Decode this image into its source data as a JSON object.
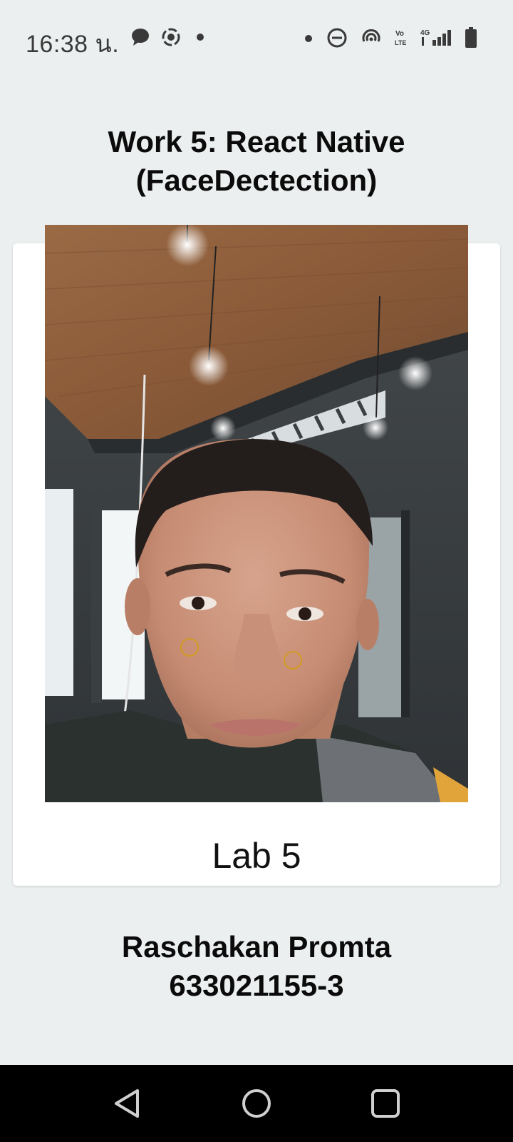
{
  "status_bar": {
    "time": "16:38 น.",
    "icons_left": [
      "chat-bubble-icon",
      "record-circle-icon",
      "dot-icon"
    ],
    "icons_right": [
      "dot-icon",
      "do-not-disturb-icon",
      "hotspot-icon",
      "volte-icon",
      "4g-signal-icon",
      "battery-icon"
    ],
    "volte_label": "Vo LTE",
    "network_label": "4G"
  },
  "title": {
    "line1": "Work 5: React Native",
    "line2": "(FaceDectection)"
  },
  "card": {
    "caption": "Lab 5"
  },
  "author": {
    "name": "Raschakan Promta",
    "id": "633021155-3"
  },
  "nav": {
    "buttons": [
      "back-icon",
      "home-icon",
      "recents-icon"
    ]
  },
  "colors": {
    "background": "#ecefef",
    "card": "#ffffff",
    "nav_bar": "#000000",
    "marker": "#d29a22"
  }
}
